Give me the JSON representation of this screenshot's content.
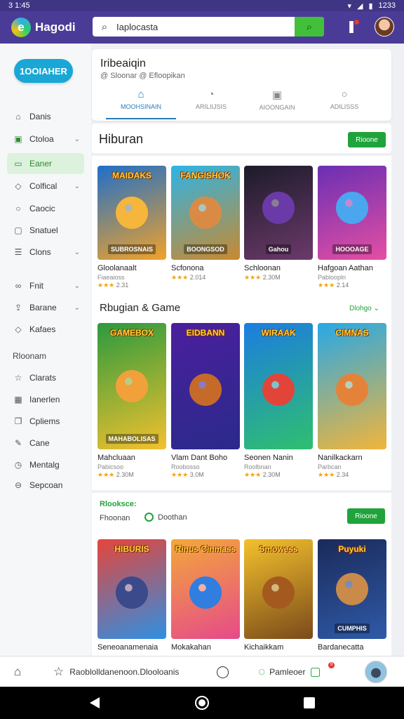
{
  "status": {
    "time": "3 1:45",
    "battery": "1233"
  },
  "appbar": {
    "logo_letter": "e",
    "logo_text": "Hagodi",
    "search_value": "Iaplocasta",
    "bell_icon": "bell-icon"
  },
  "sidebar": {
    "primary_button": "1OOIAHER",
    "items": [
      {
        "label": "Danis",
        "icon": "home-icon",
        "chev": false
      },
      {
        "label": "Ctoloa",
        "icon": "square-icon",
        "chev": true
      },
      {
        "label": "Eaner",
        "icon": "grid-icon",
        "chev": false,
        "active": true
      },
      {
        "label": "Colfical",
        "icon": "pin-icon",
        "chev": true
      },
      {
        "label": "Caocic",
        "icon": "chat-icon",
        "chev": false
      },
      {
        "label": "Snatuel",
        "icon": "message-icon",
        "chev": false
      },
      {
        "label": "Clons",
        "icon": "list-icon",
        "chev": true
      }
    ],
    "items2": [
      {
        "label": "Fnit",
        "icon": "link-icon",
        "chev": true
      },
      {
        "label": "Barane",
        "icon": "share-icon",
        "chev": true
      },
      {
        "label": "Kafaes",
        "icon": "tag-icon",
        "chev": false
      }
    ],
    "section_head": "Rloonam",
    "items3": [
      {
        "label": "Clarats",
        "icon": "star-icon"
      },
      {
        "label": "Ianerlen",
        "icon": "calendar-icon"
      },
      {
        "label": "Cpliems",
        "icon": "doc-icon"
      },
      {
        "label": "Cane",
        "icon": "edit-icon"
      },
      {
        "label": "Mentalg",
        "icon": "clock-icon"
      },
      {
        "label": "Sepcoan",
        "icon": "minus-circle-icon"
      }
    ]
  },
  "header": {
    "title": "Iribeaiqin",
    "subtitle": "@ Sloonar  @ Efloopikan",
    "tabs": [
      {
        "label": "MOOHSINAIN",
        "icon": "store-icon",
        "active": true
      },
      {
        "label": "ARILIIJSIS",
        "icon": "face-icon",
        "active": false
      },
      {
        "label": "AIOONGAIN",
        "icon": "image-icon",
        "active": false
      },
      {
        "label": "ADILISSS",
        "icon": "circle-icon",
        "active": false
      }
    ]
  },
  "section1": {
    "title": "Hiburan",
    "button": "Rioone"
  },
  "row1": [
    {
      "cover_title": "MAIDAKS",
      "cover_foot": "SUBROSNAIS",
      "name": "Gloolanaalt",
      "sub": "Fiaeaioss",
      "rating": "2.31",
      "colors": [
        "#1e6fc9",
        "#f1a22a"
      ],
      "blob": "#f6b53b"
    },
    {
      "cover_title": "FANGISHOK",
      "cover_foot": "BOONGSOD",
      "name": "Scfonona",
      "sub": "",
      "rating": "2.014",
      "colors": [
        "#2db4e6",
        "#c9892f"
      ],
      "blob": "#d98b46"
    },
    {
      "cover_title": "",
      "cover_foot": "Gahou",
      "name": "Schloonan",
      "sub": "",
      "rating": "2.30M",
      "colors": [
        "#1d1b2a",
        "#6b3a6a"
      ],
      "blob": "#6a3aa8"
    },
    {
      "cover_title": "",
      "cover_foot": "HOOOAGE",
      "name": "Hafgoan Aathan",
      "sub": "Pabloopln",
      "rating": "2.14",
      "colors": [
        "#6a2fb3",
        "#e54fa3"
      ],
      "blob": "#4aa6ef"
    }
  ],
  "section2": {
    "title": "Rbugian & Game",
    "link": "Dlohgo"
  },
  "row2": [
    {
      "cover_title": "GAMEBOX",
      "cover_foot": "MAHABOLISAS",
      "name": "Mahcluaan",
      "sub": "Pabicsoo",
      "rating": "2.30M",
      "colors": [
        "#2b9a3e",
        "#f3c12d"
      ],
      "blob": "#f2a03a"
    },
    {
      "cover_title": "EIDBANN",
      "cover_foot": "",
      "name": "Vlam Dant Boho",
      "sub": "Roobosso",
      "rating": "3.0M",
      "colors": [
        "#4b1f9e",
        "#2a2a8a"
      ],
      "blob": "#c66a2a"
    },
    {
      "cover_title": "WIRAAK",
      "cover_foot": "",
      "name": "Seonen Nanin",
      "sub": "Roolbnan",
      "rating": "2.30M",
      "colors": [
        "#1c7de0",
        "#2fbf6f"
      ],
      "blob": "#e2443a"
    },
    {
      "cover_title": "CIMNAS",
      "cover_foot": "",
      "name": "Nanilkackarn",
      "sub": "Parbcan",
      "rating": "2.34",
      "colors": [
        "#28a8e6",
        "#f1b53b"
      ],
      "blob": "#e5823a"
    }
  ],
  "section3": {
    "title": "Rlooksce:",
    "sub1": "Fhoonan",
    "sub2": "Doothan",
    "button": "Rioone"
  },
  "row3": [
    {
      "cover_title": "HIBURIS",
      "cover_foot": "",
      "name": "Seneoanamenaia",
      "colors": [
        "#e5453a",
        "#2f8fe3"
      ],
      "blob": "#3a4a8a"
    },
    {
      "cover_title": "Rinus Cinmass",
      "cover_foot": "",
      "name": "Mokakahan",
      "colors": [
        "#f3a83a",
        "#e64a8a"
      ],
      "blob": "#2f7ee0"
    },
    {
      "cover_title": "Smowess",
      "cover_foot": "",
      "name": "Kichaikkam",
      "colors": [
        "#f3c12d",
        "#7a4a1a"
      ],
      "blob": "#a45a1f"
    },
    {
      "cover_title": "Puyuki",
      "cover_foot": "CUMPHIS",
      "name": "Bardanecatta",
      "colors": [
        "#1b2a5a",
        "#2f5aa8"
      ],
      "blob": "#c98a4a"
    }
  ],
  "bottomnav": {
    "home_icon": "home-icon",
    "center_text": "Raoblolldanenoon.Dlooloanis",
    "chat_icon": "chat-icon",
    "right_text": "Pamleoer",
    "badge": "9"
  }
}
